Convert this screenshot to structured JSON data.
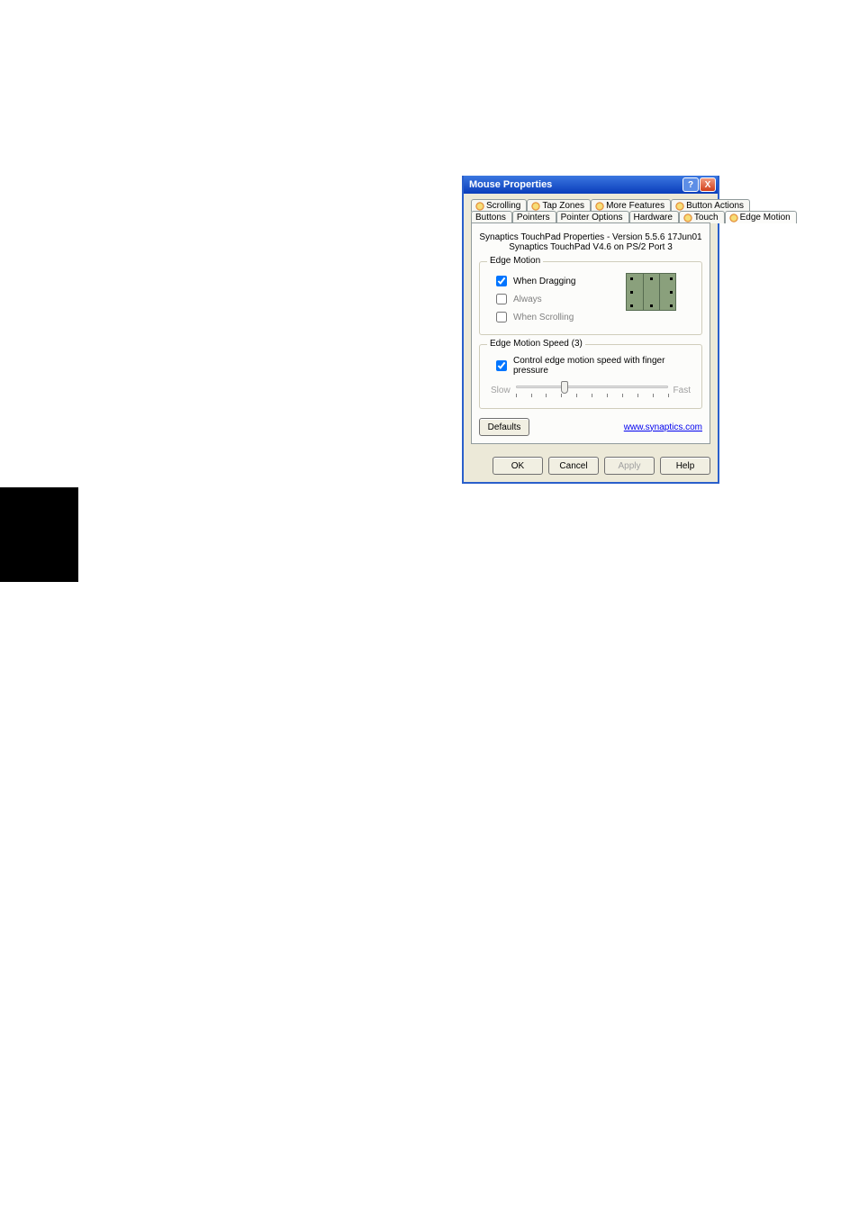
{
  "window": {
    "title": "Mouse Properties"
  },
  "captions": {
    "help": "?",
    "close": "X"
  },
  "tabs": {
    "row1": [
      {
        "label": "Scrolling",
        "icon": true
      },
      {
        "label": "Tap Zones",
        "icon": true
      },
      {
        "label": "More Features",
        "icon": true
      },
      {
        "label": "Button Actions",
        "icon": true
      }
    ],
    "row2": [
      {
        "label": "Buttons",
        "icon": false
      },
      {
        "label": "Pointers",
        "icon": false
      },
      {
        "label": "Pointer Options",
        "icon": false
      },
      {
        "label": "Hardware",
        "icon": false
      },
      {
        "label": "Touch",
        "icon": true
      },
      {
        "label": "Edge Motion",
        "icon": true,
        "active": true
      }
    ]
  },
  "header": {
    "line1": "Synaptics TouchPad Properties - Version 5.5.6 17Jun01",
    "line2": "Synaptics TouchPad V4.6 on PS/2 Port 3"
  },
  "groups": {
    "edge_motion": {
      "title": "Edge Motion",
      "when_dragging": {
        "label": "When Dragging",
        "checked": true
      },
      "always": {
        "label": "Always",
        "checked": false
      },
      "when_scrolling": {
        "label": "When Scrolling",
        "checked": false
      }
    },
    "speed": {
      "title": "Edge Motion Speed (3)",
      "control_pressure": {
        "label": "Control edge motion speed with finger pressure",
        "checked": true
      },
      "slow": "Slow",
      "fast": "Fast",
      "value": 3,
      "min": 0,
      "max": 10
    }
  },
  "footer": {
    "defaults": "Defaults",
    "link": "www.synaptics.com"
  },
  "buttons": {
    "ok": "OK",
    "cancel": "Cancel",
    "apply": "Apply",
    "help": "Help"
  }
}
